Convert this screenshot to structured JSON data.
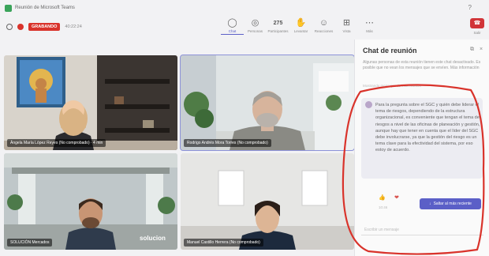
{
  "window": {
    "title": "Reunión de Microsoft Teams"
  },
  "toolbar": {
    "rec_badge": "GRABANDO",
    "timer": "40:22:24",
    "tools": [
      {
        "icon": "chat-icon",
        "glyph": "◯",
        "label": "Chat",
        "active": true
      },
      {
        "icon": "reactions-icon",
        "glyph": "◎",
        "label": "Personas"
      },
      {
        "icon": "people-icon",
        "glyph": "275",
        "label": "Participantes"
      },
      {
        "icon": "raise-hand-icon",
        "glyph": "✋",
        "label": "Levantar"
      },
      {
        "icon": "reaction-icon",
        "glyph": "☺",
        "label": "Reacciones"
      },
      {
        "icon": "view-icon",
        "glyph": "⊞",
        "label": "Vista"
      },
      {
        "icon": "more-icon",
        "glyph": "⋯",
        "label": "Más"
      }
    ],
    "leave_label": "Salir"
  },
  "participants": [
    {
      "name": "Ángela María López Reyes (No comprobado) · 4 min"
    },
    {
      "name": "Rodrigo Andrés Mora Torres (No comprobado)"
    },
    {
      "name": "SOLUCIÓN Mercados"
    },
    {
      "name": "Manuel Castillo Herrera (No comprobado)"
    }
  ],
  "tile_overlays": {
    "solution_logo": "solucion"
  },
  "chat": {
    "title": "Chat de reunión",
    "notice": "Algunas personas de esta reunión tienen este chat desactivado. Es posible que no vean los mensajes que se envíen. Más información",
    "filter_note": "Mostrando mensajes de esta reunión",
    "message": "Para la pregunta sobre el SGC y quién debe liderar el tema de riesgos, dependiendo de la estructura organizacional, es conveniente que tengan el tema de riesgos a nivel de las oficinas de planeación y gestión, aunque hay que tener en cuenta que el líder del SGC debe involucrarse, ya que la gestión del riesgo es un tema clave para la efectividad del sistema, por eso estoy de acuerdo.",
    "emojis": [
      "👍",
      "❤"
    ],
    "time": "10:46",
    "jump_label": "Saltar al más reciente",
    "compose_placeholder": "Escribir un mensaje"
  },
  "colors": {
    "accent": "#5b5fc7",
    "leave": "#d13438",
    "recording": "#d9332b"
  }
}
